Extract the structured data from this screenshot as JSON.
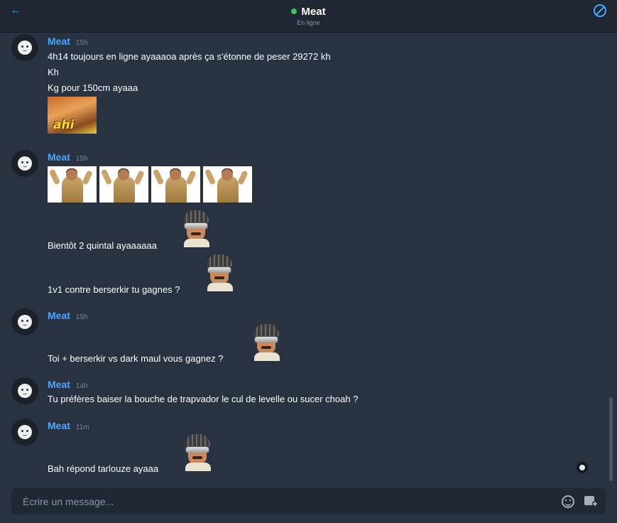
{
  "header": {
    "back_icon": "arrow-left-icon",
    "title": "Meat",
    "status": "En ligne",
    "status_color": "#43c15b",
    "block_icon": "block-icon",
    "accent_color": "#4aa8ff"
  },
  "messages": [
    {
      "author": "Meat",
      "time": "15h",
      "lines": [
        "4h14 toujours en ligne ayaaaoa après ça s'étonne de peser 29272 kh",
        "Kh",
        "Kg pour 150cm ayaaa"
      ],
      "image_text": "ahi"
    },
    {
      "author": "Meat",
      "time": "15h",
      "lines": [
        "Bientôt 2 quintal ayaaaaaa",
        "1v1 contre berserkir tu gagnes ?"
      ]
    },
    {
      "author": "Meat",
      "time": "15h",
      "lines": [
        "Toi + berserkir vs dark maul vous gagnez ?"
      ]
    },
    {
      "author": "Meat",
      "time": "14h",
      "lines": [
        "Tu préfères baiser la bouche de trapvador le cul de levelle ou sucer choah ?"
      ]
    },
    {
      "author": "Meat",
      "time": "11m",
      "lines": [
        "Bah répond tarlouze ayaaa"
      ]
    }
  ],
  "composer": {
    "placeholder": "Écrire un message...",
    "emoji_icon": "emoji-icon",
    "image_icon": "add-image-icon"
  }
}
